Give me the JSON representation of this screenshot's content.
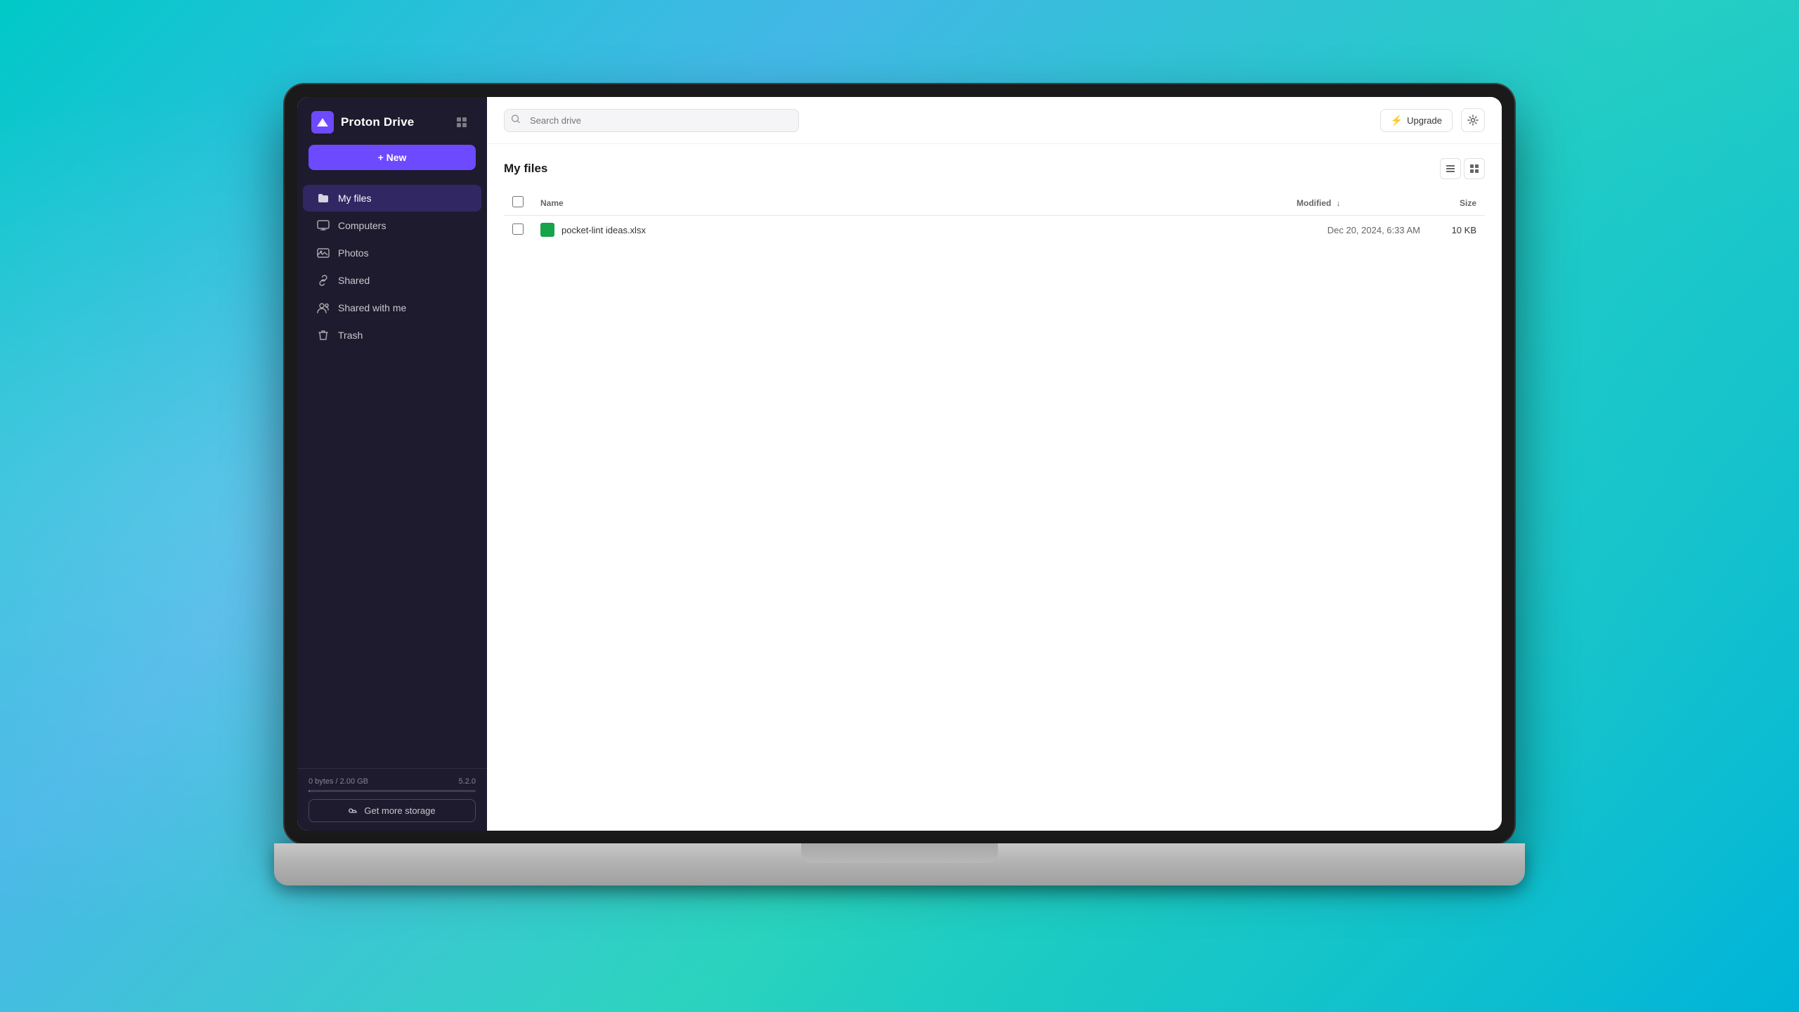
{
  "background": {
    "type": "teal-gradient"
  },
  "app": {
    "name": "Proton Drive",
    "logo_alt": "Proton Drive Logo"
  },
  "sidebar": {
    "logo_label": "Proton Drive",
    "new_button_label": "+ New",
    "nav_items": [
      {
        "id": "my-files",
        "label": "My files",
        "icon": "folder",
        "active": true
      },
      {
        "id": "computers",
        "label": "Computers",
        "icon": "monitor"
      },
      {
        "id": "photos",
        "label": "Photos",
        "icon": "image"
      },
      {
        "id": "shared",
        "label": "Shared",
        "icon": "link"
      },
      {
        "id": "shared-with-me",
        "label": "Shared with me",
        "icon": "users"
      },
      {
        "id": "trash",
        "label": "Trash",
        "icon": "trash"
      }
    ],
    "storage": {
      "used": "0 bytes",
      "total": "2.00 GB",
      "version": "5.2.0",
      "percent": 0.5,
      "get_more_label": "Get more storage"
    }
  },
  "topbar": {
    "search_placeholder": "Search drive",
    "upgrade_label": "Upgrade",
    "settings_label": "Settings"
  },
  "main": {
    "page_title": "My files",
    "table": {
      "columns": [
        {
          "id": "name",
          "label": "Name"
        },
        {
          "id": "modified",
          "label": "Modified",
          "sorted": true
        },
        {
          "id": "size",
          "label": "Size"
        }
      ],
      "rows": [
        {
          "id": "file-1",
          "name": "pocket-lint ideas.xlsx",
          "icon_color": "#16a34a",
          "modified": "Dec 20, 2024, 6:33 AM",
          "size": "10 KB"
        }
      ]
    }
  }
}
